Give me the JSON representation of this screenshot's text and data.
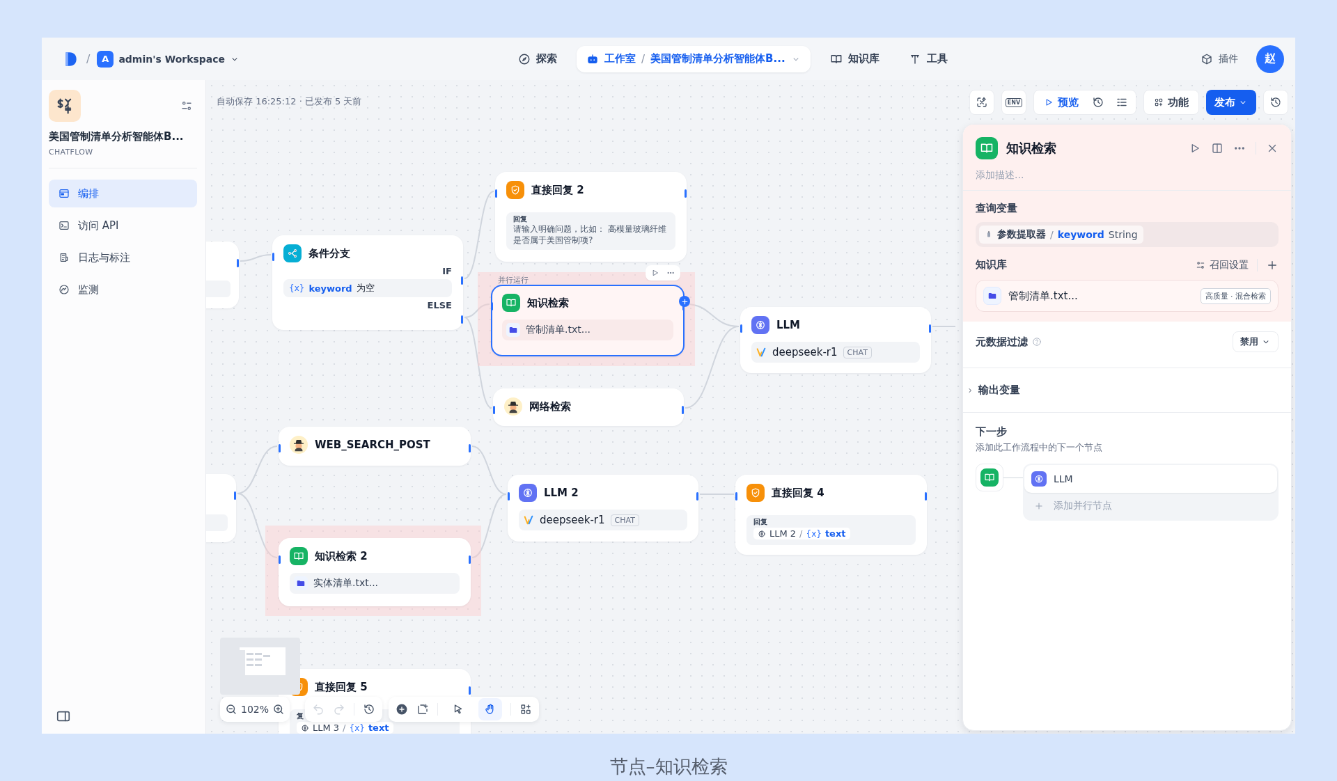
{
  "header": {
    "separator": "/",
    "workspace": {
      "initial": "A",
      "name": "admin's Workspace"
    },
    "nav": [
      {
        "label": "探索",
        "selected": false
      },
      {
        "label": "工作室",
        "selected": true,
        "separator": "/",
        "app": "美国管制清单分析智能体B..."
      },
      {
        "label": "知识库",
        "selected": false
      },
      {
        "label": "工具",
        "selected": false
      }
    ],
    "plugins": "插件",
    "avatar": "赵"
  },
  "sidebar": {
    "app_name": "美国管制清单分析智能体B...",
    "app_type": "CHATFLOW",
    "items": [
      {
        "label": "编排",
        "selected": true
      },
      {
        "label": "访问 API",
        "selected": false
      },
      {
        "label": "日志与标注",
        "selected": false
      },
      {
        "label": "监测",
        "selected": false
      }
    ]
  },
  "canvas": {
    "status": "自动保存 16:25:12 · 已发布 5 天前",
    "env": "ENV",
    "preview": "预览",
    "features": "功能",
    "publish": "发布",
    "nodes": [
      {
        "kind": "stub",
        "selected": false,
        "highlighted": false
      },
      {
        "kind": "branch",
        "title": "条件分支",
        "selected": false,
        "highlighted": false,
        "if": "IF",
        "else": "ELSE",
        "condition": {
          "var_mark": "{x}",
          "var": "keyword",
          "op": "为空"
        }
      },
      {
        "kind": "answer",
        "title": "直接回复 2",
        "selected": false,
        "highlighted": false,
        "label": "回复",
        "text": "请输入明确问题，比如： 高模量玻璃纤维是否属于美国管制项?"
      },
      {
        "kind": "knowledge",
        "title": "知识检索",
        "selected": true,
        "highlighted": true,
        "group_label": "并行运行",
        "dataset": "管制清单.txt..."
      },
      {
        "kind": "llm",
        "title": "LLM",
        "selected": false,
        "highlighted": false,
        "model": "deepseek-r1",
        "mode": "CHAT"
      },
      {
        "kind": "tool",
        "title": "网络检索",
        "selected": false,
        "highlighted": false
      },
      {
        "kind": "tool",
        "title": "WEB_SEARCH_POST",
        "selected": false,
        "highlighted": false
      },
      {
        "kind": "stub",
        "selected": false,
        "highlighted": false
      },
      {
        "kind": "llm",
        "title": "LLM 2",
        "selected": false,
        "highlighted": false,
        "model": "deepseek-r1",
        "mode": "CHAT"
      },
      {
        "kind": "answer",
        "title": "直接回复 4",
        "selected": false,
        "highlighted": false,
        "label": "回复",
        "ref": {
          "node": "LLM 2",
          "sep": "/",
          "var_mark": "{x}",
          "var": "text"
        }
      },
      {
        "kind": "knowledge",
        "title": "知识检索 2",
        "selected": false,
        "highlighted": true,
        "dataset": "实体清单.txt..."
      },
      {
        "kind": "answer",
        "title": "直接回复 5",
        "selected": false,
        "highlighted": false,
        "label": "复",
        "ref": {
          "node": "LLM 3",
          "sep": "/",
          "var_mark": "{x}",
          "var": "text"
        }
      }
    ],
    "zoom": "102%",
    "undo_disabled": true,
    "redo_disabled": true,
    "modes": [
      {
        "selected": false
      },
      {
        "selected": true
      }
    ]
  },
  "panel": {
    "title": "知识检索",
    "description_placeholder": "添加描述...",
    "query": {
      "label": "查询变量",
      "node": "参数提取器",
      "sep": "/",
      "var": "keyword",
      "type": "String"
    },
    "knowledge": {
      "label": "知识库",
      "recall": "召回设置",
      "datasets": [
        {
          "name": "管制清单.txt...",
          "tag": "高质量 · 混合检索"
        }
      ]
    },
    "metadata": {
      "label": "元数据过滤",
      "value": "禁用"
    },
    "output": {
      "label": "输出变量",
      "expanded": false
    },
    "next": {
      "label": "下一步",
      "hint": "添加此工作流程中的下一个节点",
      "nodes": [
        {
          "kind": "llm",
          "title": "LLM"
        }
      ],
      "add_parallel": "添加并行节点"
    }
  },
  "caption": "节点–知识检索"
}
